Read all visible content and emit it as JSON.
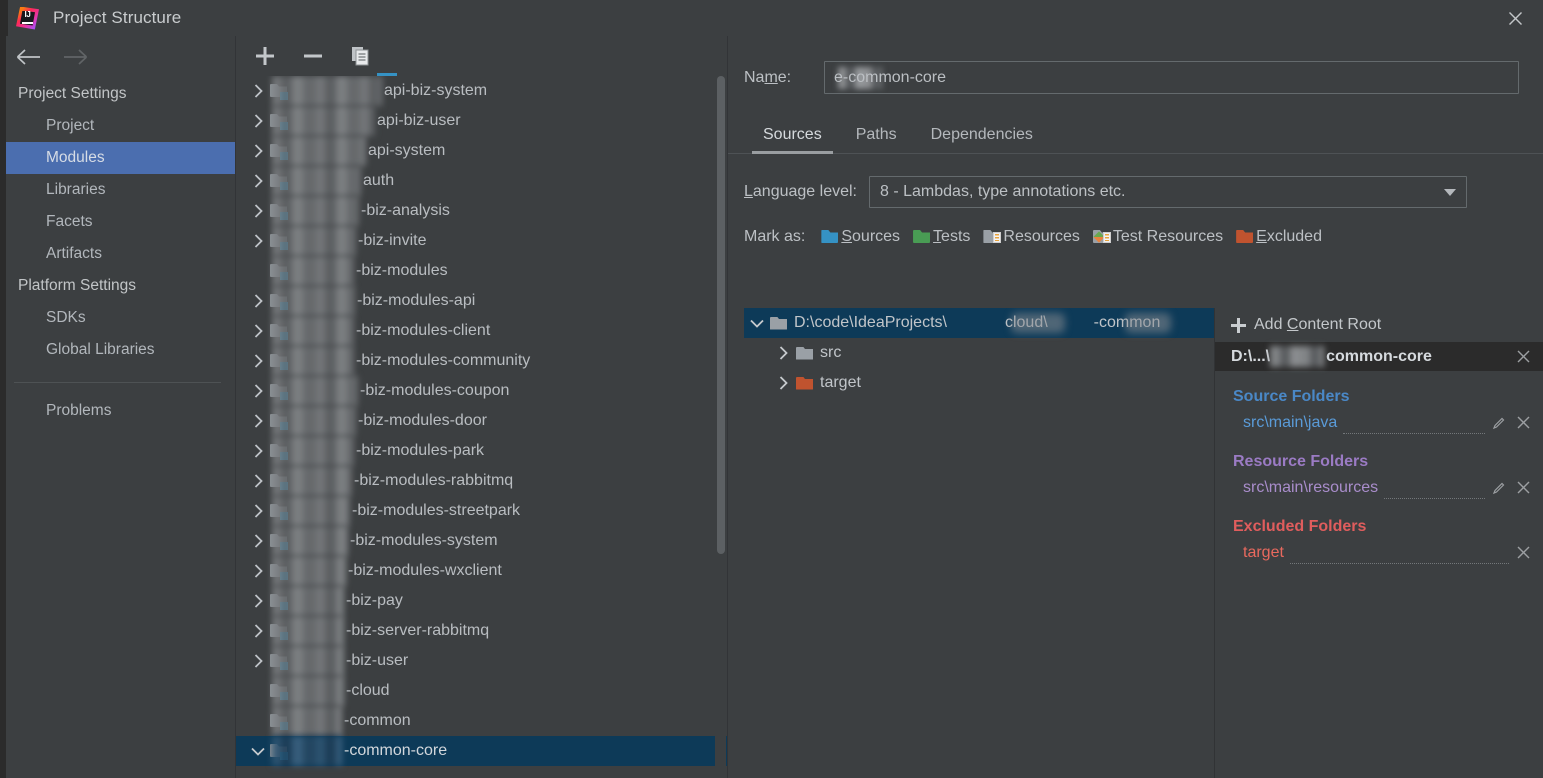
{
  "window": {
    "title": "Project Structure",
    "logo_text": "IJ",
    "close_label": "×"
  },
  "sidebar": {
    "back_icon": "arrow-left-icon",
    "forward_icon": "arrow-right-icon",
    "sections": [
      {
        "title": "Project Settings",
        "items": [
          {
            "label": "Project",
            "selected": false
          },
          {
            "label": "Modules",
            "selected": true
          },
          {
            "label": "Libraries",
            "selected": false
          },
          {
            "label": "Facets",
            "selected": false
          },
          {
            "label": "Artifacts",
            "selected": false
          }
        ]
      },
      {
        "title": "Platform Settings",
        "items": [
          {
            "label": "SDKs",
            "selected": false
          },
          {
            "label": "Global Libraries",
            "selected": false
          }
        ]
      }
    ],
    "problems_label": "Problems"
  },
  "module_list": {
    "toolbar": {
      "add_label": "+",
      "remove_label": "−",
      "copy_label": "copy-module-icon"
    },
    "modules": [
      {
        "name": "api-biz-system",
        "expandable": true,
        "expanded": false,
        "selected": false,
        "blur_width": 110
      },
      {
        "name": "api-biz-user",
        "expandable": true,
        "expanded": false,
        "selected": false,
        "blur_width": 103
      },
      {
        "name": "api-system",
        "expandable": true,
        "expanded": false,
        "selected": false,
        "blur_width": 94
      },
      {
        "name": "auth",
        "expandable": true,
        "expanded": false,
        "selected": false,
        "blur_width": 89
      },
      {
        "name": "-biz-analysis",
        "expandable": true,
        "expanded": false,
        "selected": false,
        "blur_width": 87
      },
      {
        "name": "-biz-invite",
        "expandable": true,
        "expanded": false,
        "selected": false,
        "blur_width": 84
      },
      {
        "name": "-biz-modules",
        "expandable": false,
        "expanded": false,
        "selected": false,
        "blur_width": 82
      },
      {
        "name": "-biz-modules-api",
        "expandable": true,
        "expanded": false,
        "selected": false,
        "blur_width": 83
      },
      {
        "name": "-biz-modules-client",
        "expandable": true,
        "expanded": false,
        "selected": false,
        "blur_width": 82
      },
      {
        "name": "-biz-modules-community",
        "expandable": true,
        "expanded": false,
        "selected": false,
        "blur_width": 82
      },
      {
        "name": "-biz-modules-coupon",
        "expandable": true,
        "expanded": false,
        "selected": false,
        "blur_width": 86
      },
      {
        "name": "-biz-modules-door",
        "expandable": true,
        "expanded": false,
        "selected": false,
        "blur_width": 84
      },
      {
        "name": "-biz-modules-park",
        "expandable": true,
        "expanded": false,
        "selected": false,
        "blur_width": 82
      },
      {
        "name": "-biz-modules-rabbitmq",
        "expandable": true,
        "expanded": false,
        "selected": false,
        "blur_width": 80
      },
      {
        "name": "-biz-modules-streetpark",
        "expandable": true,
        "expanded": false,
        "selected": false,
        "blur_width": 78
      },
      {
        "name": "-biz-modules-system",
        "expandable": true,
        "expanded": false,
        "selected": false,
        "blur_width": 76
      },
      {
        "name": "-biz-modules-wxclient",
        "expandable": true,
        "expanded": false,
        "selected": false,
        "blur_width": 74
      },
      {
        "name": "-biz-pay",
        "expandable": true,
        "expanded": false,
        "selected": false,
        "blur_width": 72
      },
      {
        "name": "-biz-server-rabbitmq",
        "expandable": true,
        "expanded": false,
        "selected": false,
        "blur_width": 72
      },
      {
        "name": "-biz-user",
        "expandable": true,
        "expanded": false,
        "selected": false,
        "blur_width": 72
      },
      {
        "name": "-cloud",
        "expandable": false,
        "expanded": false,
        "selected": false,
        "blur_width": 72
      },
      {
        "name": "-common",
        "expandable": false,
        "expanded": false,
        "selected": false,
        "blur_width": 70
      },
      {
        "name": "-common-core",
        "expandable": true,
        "expanded": true,
        "selected": true,
        "blur_width": 70
      }
    ]
  },
  "detail": {
    "name_label": "Name:",
    "name_label_pre": "Na",
    "name_label_underlined": "m",
    "name_label_post": "e:",
    "name_value": "e-common-core",
    "name_value_prefix_hidden": ")",
    "tabs": [
      {
        "label": "Sources",
        "active": true
      },
      {
        "label": "Paths",
        "active": false
      },
      {
        "label": "Dependencies",
        "active": false
      }
    ],
    "language_level": {
      "label": "Language level:",
      "label_underlined": "L",
      "label_rest": "anguage level:",
      "value": "8 - Lambdas, type annotations etc."
    },
    "mark_as": {
      "label": "Mark as:",
      "options": [
        {
          "label": "Sources",
          "underlined": "S",
          "rest": "ources",
          "color": "#3592c4",
          "style": "folder"
        },
        {
          "label": "Tests",
          "underlined": "T",
          "rest": "ests",
          "color": "#499c54",
          "style": "folder"
        },
        {
          "label": "Resources",
          "underlined": "",
          "rest": "Resources",
          "color": "#9aa0a6",
          "style": "folder-lines"
        },
        {
          "label": "Test Resources",
          "underlined": "",
          "rest": "Test Resources",
          "color": "#9aa0a6",
          "style": "folder-lines-diamond"
        },
        {
          "label": "Excluded",
          "underlined": "E",
          "rest": "xcluded",
          "color": "#c0532f",
          "style": "folder"
        }
      ]
    },
    "content_tree": {
      "root": {
        "label_part1": "D:\\code\\IdeaProjects\\",
        "label_part2": "cloud\\",
        "label_part3": "-common",
        "expanded": true,
        "selected": true,
        "color": "#9aa0a6"
      },
      "children": [
        {
          "label": "src",
          "color": "#9aa0a6",
          "expandable": true
        },
        {
          "label": "target",
          "color": "#c0532f",
          "expandable": true
        }
      ]
    },
    "content_roots_panel": {
      "add_label": "Add Content Root",
      "add_label_pre": "Add ",
      "add_label_underlined": "C",
      "add_label_post": "ontent Root",
      "root_header": "D:\\...\\",
      "root_header_suffix": "common-core",
      "close_icon": "close-icon",
      "groups": [
        {
          "title": "Source Folders",
          "color": "#4a88c7",
          "item_color": "#5a9bd8",
          "items": [
            {
              "name": "src\\main\\java",
              "editable": true,
              "removable": true
            }
          ]
        },
        {
          "title": "Resource Folders",
          "color": "#9b7bc4",
          "item_color": "#a98dcb",
          "items": [
            {
              "name": "src\\main\\resources",
              "editable": true,
              "removable": true
            }
          ]
        },
        {
          "title": "Excluded Folders",
          "color": "#e05d5d",
          "item_color": "#e8695e",
          "items": [
            {
              "name": "target",
              "editable": false,
              "removable": true
            }
          ]
        }
      ]
    }
  },
  "colors": {
    "window_bg": "#3c3f41",
    "selection_blue": "#4b6eaf",
    "tree_selection": "#0d3a58",
    "accent_cyan": "#3592c4",
    "header_dark": "#2b2b2b"
  }
}
